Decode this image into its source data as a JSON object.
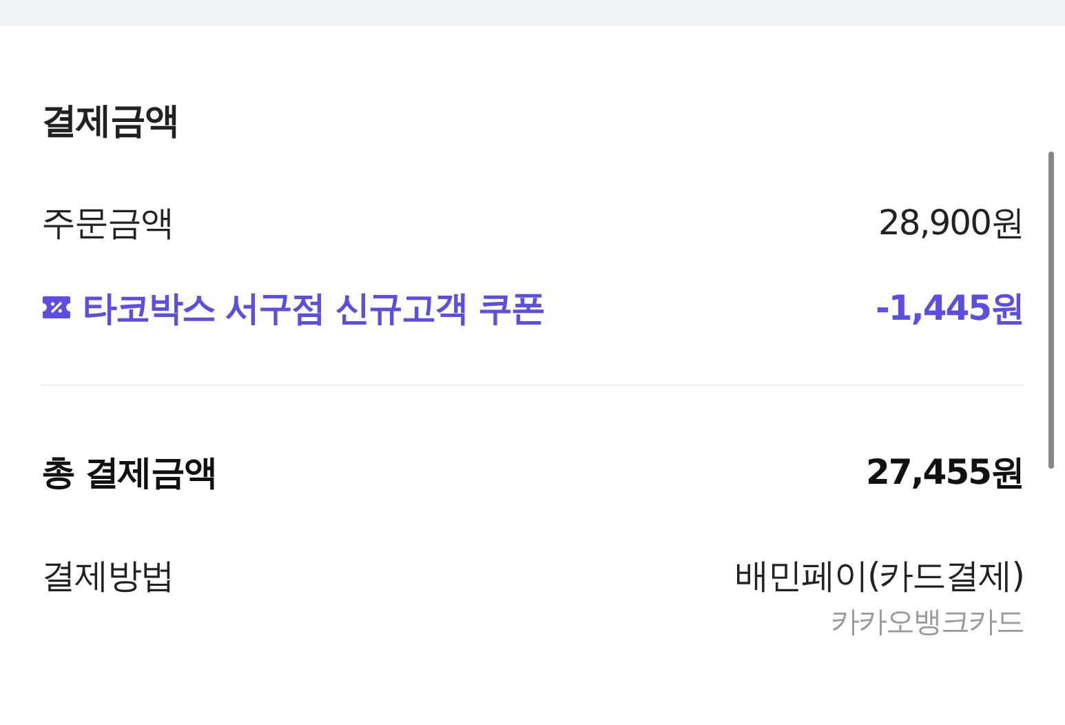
{
  "section": {
    "title": "결제금액"
  },
  "rows": [
    {
      "kind": "plain",
      "label": "주문금액",
      "value": "28,900원"
    },
    {
      "kind": "discount",
      "label": "타코박스 서구점 신규고객 쿠폰",
      "value": "-1,445원"
    }
  ],
  "total": {
    "label": "총 결제금액",
    "value": "27,455원"
  },
  "payment": {
    "label": "결제방법",
    "value": "배민페이(카드결제)",
    "detail": "카카오뱅크카드"
  }
}
